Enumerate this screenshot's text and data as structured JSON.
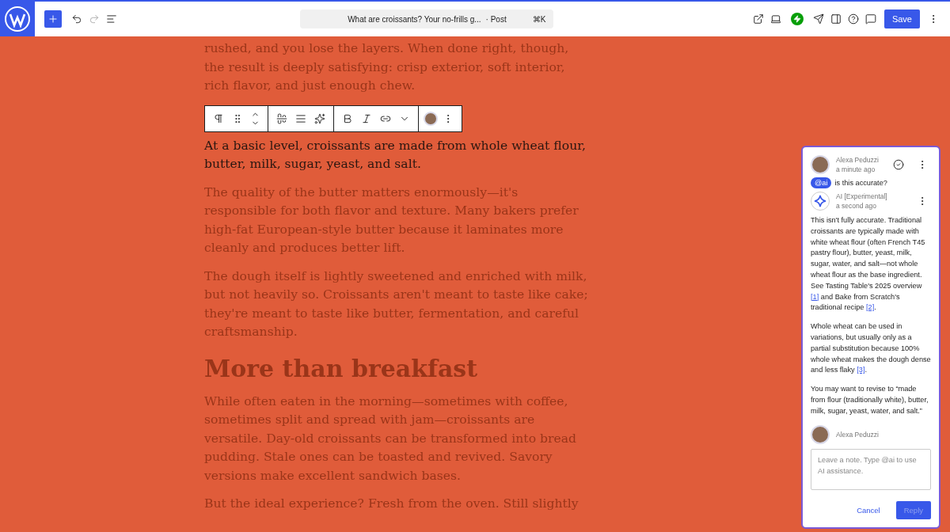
{
  "topbar": {
    "document_title": "What are croissants? Your no-frills g...",
    "post_type": "· Post",
    "shortcut": "⌘K",
    "save": "Save",
    "redo_disabled": true
  },
  "blocks": [
    {
      "kind": "paragraph",
      "focused": false,
      "text": "rushed, and you lose the layers. When done right, though, the result is deeply satisfying: crisp exterior, soft interior, rich flavor, and just enough chew."
    },
    {
      "kind": "toolbar"
    },
    {
      "kind": "paragraph",
      "focused": true,
      "text": "At a basic level, croissants are made from whole wheat flour, butter, milk, sugar, yeast, and salt."
    },
    {
      "kind": "paragraph",
      "focused": false,
      "text": "The quality of the butter matters enormously—it's responsible for both flavor and texture. Many bakers prefer high-fat European-style butter because it laminates more cleanly and produces better lift."
    },
    {
      "kind": "paragraph",
      "focused": false,
      "text": "The dough itself is lightly sweetened and enriched with milk, but not heavily so. Croissants aren't meant to taste like cake; they're meant to taste like butter, fermentation, and careful craftsmanship."
    },
    {
      "kind": "heading",
      "text": "More than breakfast"
    },
    {
      "kind": "paragraph",
      "focused": false,
      "text": "While often eaten in the morning—sometimes with coffee, sometimes split and spread with jam—croissants are versatile. Day-old croissants can be transformed into bread pudding. Stale ones can be toasted and revived. Savory versions make excellent sandwich bases."
    },
    {
      "kind": "paragraph",
      "focused": false,
      "text": "But the ideal experience? Fresh from the oven. Still slightly"
    }
  ],
  "comments": {
    "thread": [
      {
        "kind": "human",
        "author": "Alexa Peduzzi",
        "time": "a minute ago",
        "resolvable": true,
        "mention": "@ai",
        "body": [
          "is this accurate?"
        ]
      },
      {
        "kind": "ai",
        "author": "AI [Experimental]",
        "time": "a second ago",
        "body": [
          "This isn't fully accurate. Traditional croissants are typically made with white wheat flour (often French T45 pastry flour), butter, yeast, milk, sugar, water, and salt—not whole wheat flour as the base ingredient. See Tasting Table's 2025 overview [1] and Bake from Scratch's traditional recipe [2].",
          "Whole wheat can be used in variations, but usually only as a partial substitution because 100% whole wheat makes the dough dense and less flaky [3].",
          "You may want to revise to “made from flour (traditionally white), butter, milk, sugar, yeast, water, and salt.”"
        ]
      }
    ],
    "reply_author": "Alexa Peduzzi",
    "placeholder": "Leave a note. Type @ai to use AI assistance.",
    "cancel": "Cancel",
    "reply": "Reply",
    "reply_disabled": true
  }
}
